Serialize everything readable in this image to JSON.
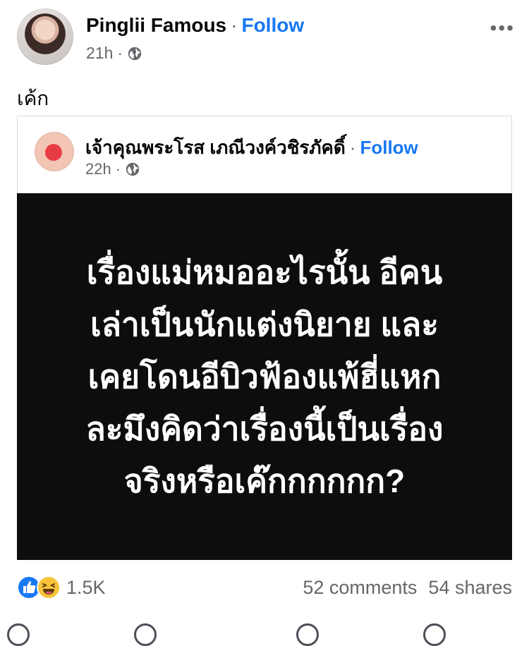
{
  "post": {
    "author": "Pinglii Famous",
    "follow_label": "Follow",
    "time": "21h",
    "separator": "·",
    "more_label": "•••",
    "text": "เค้ก"
  },
  "shared": {
    "author": "เจ้าคุณพระโรส เภณีวงค์วชิรภัคดิ์",
    "follow_label": "Follow",
    "time": "22h",
    "separator": "·",
    "image_lines": [
      "เรื่องแม่หมออะไรนั้น อีคน",
      "เล่าเป็นนักแต่งนิยาย และ",
      "เคยโดนอีบิวฟ้องแพ้ฮี่แหก",
      "ละมึงคิดว่าเรื่องนี้เป็นเรื่อง",
      "จริงหรือเค๊กกกกกก?"
    ]
  },
  "stats": {
    "reaction_count": "1.5K",
    "comments": "52 comments",
    "shares": "54 shares"
  },
  "colors": {
    "accent": "#1877f2",
    "muted": "#65676b",
    "image_bg": "#0d0d0d"
  },
  "icons": [
    "globe-icon",
    "more-icon",
    "like-icon",
    "haha-icon"
  ]
}
